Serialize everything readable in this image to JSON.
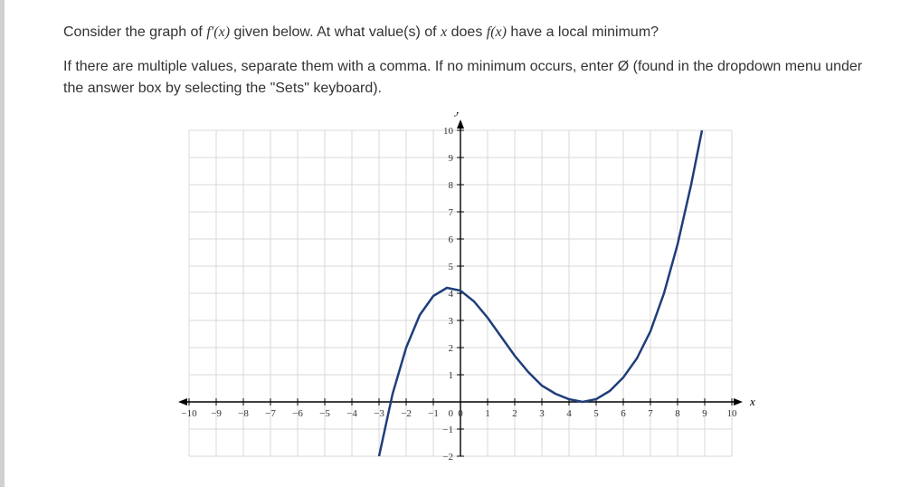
{
  "question": {
    "line1_pre": "Consider the graph of ",
    "line1_fprime": "f′(x)",
    "line1_mid": " given below. At what value(s) of ",
    "line1_x": "x",
    "line1_mid2": " does ",
    "line1_fx": "f(x)",
    "line1_end": " have a local minimum?",
    "line2_pre": "If there are multiple values, separate them with a comma. If no minimum occurs, enter ",
    "line2_sym": "Ø",
    "line2_end": " (found in the dropdown menu under the answer box by selecting the \"Sets\" keyboard)."
  },
  "chart_data": {
    "type": "line",
    "xlabel": "x",
    "ylabel": "y",
    "xlim": [
      -10,
      10
    ],
    "ylim": [
      -2,
      10
    ],
    "xticks": [
      -10,
      -9,
      -8,
      -7,
      -6,
      -5,
      -4,
      -3,
      -2,
      -1,
      0,
      1,
      2,
      3,
      4,
      5,
      6,
      7,
      8,
      9,
      10
    ],
    "yticks": [
      -2,
      -1,
      0,
      1,
      2,
      3,
      4,
      5,
      6,
      7,
      8,
      9,
      10
    ],
    "curve": [
      {
        "x": -3.0,
        "y": -2.0
      },
      {
        "x": -2.5,
        "y": 0.3
      },
      {
        "x": -2.0,
        "y": 2.0
      },
      {
        "x": -1.5,
        "y": 3.2
      },
      {
        "x": -1.0,
        "y": 3.9
      },
      {
        "x": -0.5,
        "y": 4.2
      },
      {
        "x": 0.0,
        "y": 4.1
      },
      {
        "x": 0.5,
        "y": 3.7
      },
      {
        "x": 1.0,
        "y": 3.1
      },
      {
        "x": 1.5,
        "y": 2.4
      },
      {
        "x": 2.0,
        "y": 1.7
      },
      {
        "x": 2.5,
        "y": 1.1
      },
      {
        "x": 3.0,
        "y": 0.6
      },
      {
        "x": 3.5,
        "y": 0.3
      },
      {
        "x": 4.0,
        "y": 0.1
      },
      {
        "x": 4.5,
        "y": 0.0
      },
      {
        "x": 5.0,
        "y": 0.1
      },
      {
        "x": 5.5,
        "y": 0.4
      },
      {
        "x": 6.0,
        "y": 0.9
      },
      {
        "x": 6.5,
        "y": 1.6
      },
      {
        "x": 7.0,
        "y": 2.6
      },
      {
        "x": 7.5,
        "y": 4.0
      },
      {
        "x": 8.0,
        "y": 5.8
      },
      {
        "x": 8.5,
        "y": 8.0
      },
      {
        "x": 8.9,
        "y": 10.0
      }
    ]
  }
}
